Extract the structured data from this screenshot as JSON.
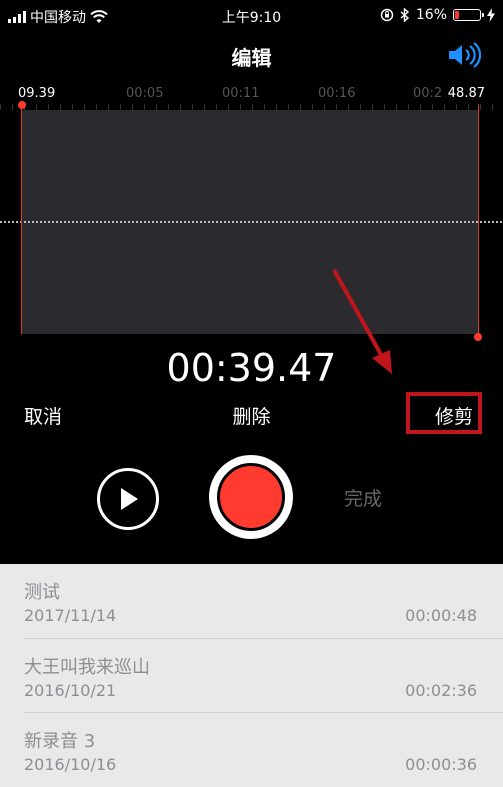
{
  "status": {
    "carrier": "中国移动",
    "time": "上午9:10",
    "battery": "16%",
    "battery_level": 0.16
  },
  "header": {
    "title": "编辑",
    "speaker_icon": "speaker-icon"
  },
  "timeline": {
    "start_label": "09.39",
    "end_label": "48.87",
    "ticks": [
      "00:05",
      "00:11",
      "00:16",
      "00:2"
    ]
  },
  "editor": {
    "duration": "00:39.47"
  },
  "actions": {
    "cancel": "取消",
    "delete": "删除",
    "trim": "修剪",
    "done": "完成"
  },
  "colors": {
    "accent": "#ff3b30",
    "annotation": "#c0151b",
    "link_blue": "#1e90ff"
  },
  "recordings": [
    {
      "name": "测试",
      "date": "2017/11/14",
      "length": "00:00:48"
    },
    {
      "name": "大王叫我来巡山",
      "date": "2016/10/21",
      "length": "00:02:36"
    },
    {
      "name": "新录音 3",
      "date": "2016/10/16",
      "length": "00:00:36"
    }
  ]
}
